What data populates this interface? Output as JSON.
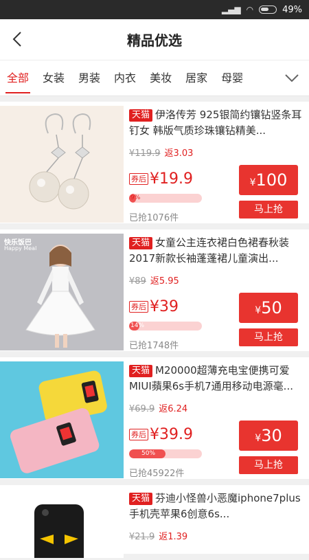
{
  "status": {
    "battery": "49%"
  },
  "header": {
    "title": "精品优选"
  },
  "tabs": [
    {
      "label": "全部",
      "active": true
    },
    {
      "label": "女装"
    },
    {
      "label": "男装"
    },
    {
      "label": "内衣"
    },
    {
      "label": "美妆"
    },
    {
      "label": "居家"
    },
    {
      "label": "母婴"
    }
  ],
  "products": [
    {
      "badge": "天猫",
      "title": "伊洛传芳 925银简约镶钻竖条耳钉女 韩版气质珍珠镶钻精美...",
      "orig_price": "¥119.9",
      "rebate": "返3.03",
      "coupon_tag": "券后",
      "price": "¥19.9",
      "progress_label": "9%",
      "progress": 0.09,
      "sold": "已抢1076件",
      "coupon_yen": "¥",
      "coupon_amount": "100",
      "buy_label": "马上抢"
    },
    {
      "badge": "天猫",
      "title": "女童公主连衣裙白色裙春秋装2017新款长袖蓬蓬裙儿童演出...",
      "orig_price": "¥89",
      "rebate": "返5.95",
      "coupon_tag": "券后",
      "price": "¥39",
      "progress_label": "14%",
      "progress": 0.14,
      "sold": "已抢1748件",
      "coupon_yen": "¥",
      "coupon_amount": "50",
      "buy_label": "马上抢",
      "image_logo": "快乐饭巴",
      "image_logo_sub": "Happy Meal"
    },
    {
      "badge": "天猫",
      "title": "M20000超薄充电宝便携可爱MIUI蘋果6s手机7通用移动电源毫...",
      "orig_price": "¥69.9",
      "rebate": "返6.24",
      "coupon_tag": "券后",
      "price": "¥39.9",
      "progress_label": "50%",
      "progress": 0.5,
      "sold": "已抢45922件",
      "coupon_yen": "¥",
      "coupon_amount": "30",
      "buy_label": "马上抢"
    },
    {
      "badge": "天猫",
      "title": "芬迪小怪兽小恶魔iphone7plus手机壳苹果6创意6s...",
      "orig_price": "¥21.9",
      "rebate": "返1.39"
    }
  ],
  "colors": {
    "accent": "#e02020"
  }
}
